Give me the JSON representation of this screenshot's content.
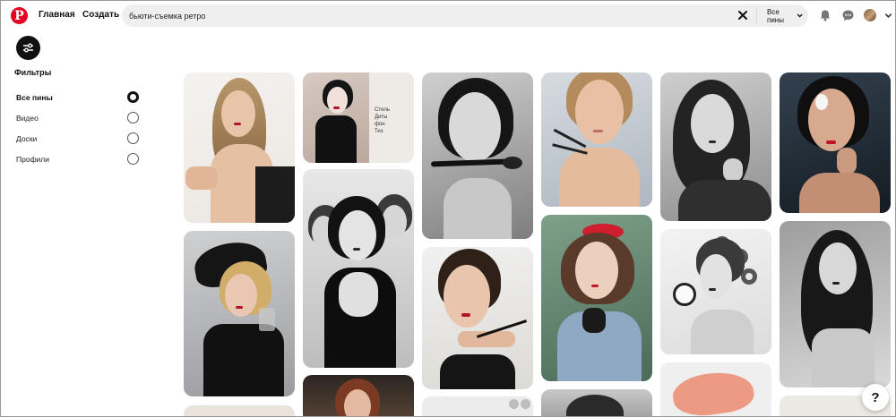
{
  "header": {
    "logo_letter": "P",
    "home_label": "Главная",
    "create_label": "Создать",
    "search_value": "бьюти-съемка ретро",
    "scope_label": "Все пины"
  },
  "filters": {
    "title": "Фильтры",
    "options": [
      "Все пины",
      "Видео",
      "Доски",
      "Профили"
    ],
    "selected": "Все пины"
  },
  "pins": [
    {
      "caption": ""
    },
    {
      "caption": "Стиль Диты фон Тиз"
    }
  ],
  "help_label": "?",
  "colors": {
    "brand": "#e60023",
    "search_bg": "#efefef",
    "lip_red": "#b0162a"
  }
}
